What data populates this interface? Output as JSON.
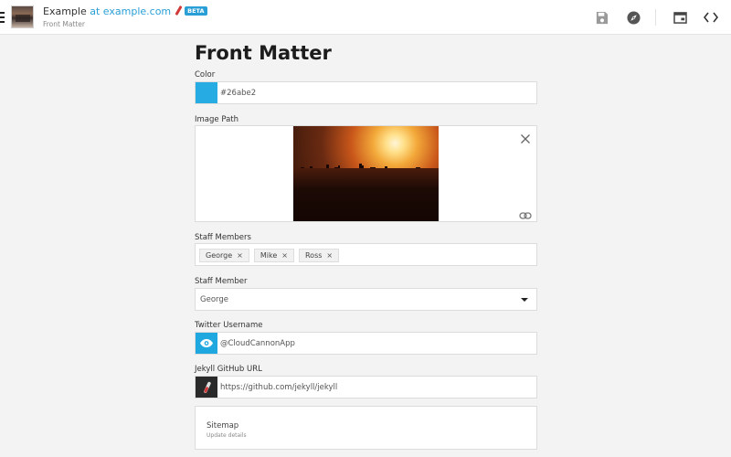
{
  "header": {
    "site_name": "Example",
    "at_text": "at",
    "domain": "example.com",
    "beta_badge": "BETA",
    "subtitle": "Front Matter"
  },
  "toolbar": {
    "icons": [
      "save-icon",
      "compass-icon",
      "window-icon",
      "code-icon"
    ]
  },
  "page": {
    "title": "Front Matter"
  },
  "fields": {
    "color": {
      "label": "Color",
      "value": "#26abe2"
    },
    "image_path": {
      "label": "Image Path"
    },
    "staff_members": {
      "label": "Staff Members",
      "items": [
        "George",
        "Mike",
        "Ross"
      ],
      "remove_symbol": "×"
    },
    "staff_member": {
      "label": "Staff Member",
      "value": "George"
    },
    "twitter_username": {
      "label": "Twitter Username",
      "value": "@CloudCannonApp"
    },
    "jekyll_github_url": {
      "label": "Jekyll GitHub URL",
      "value": "https://github.com/jekyll/jekyll"
    }
  },
  "sitemap": {
    "title": "Sitemap",
    "subtitle": "Update details"
  },
  "colors": {
    "accent": "#2a9fd6",
    "swatch": "#26abe2",
    "twitter": "#1fa8e0"
  }
}
